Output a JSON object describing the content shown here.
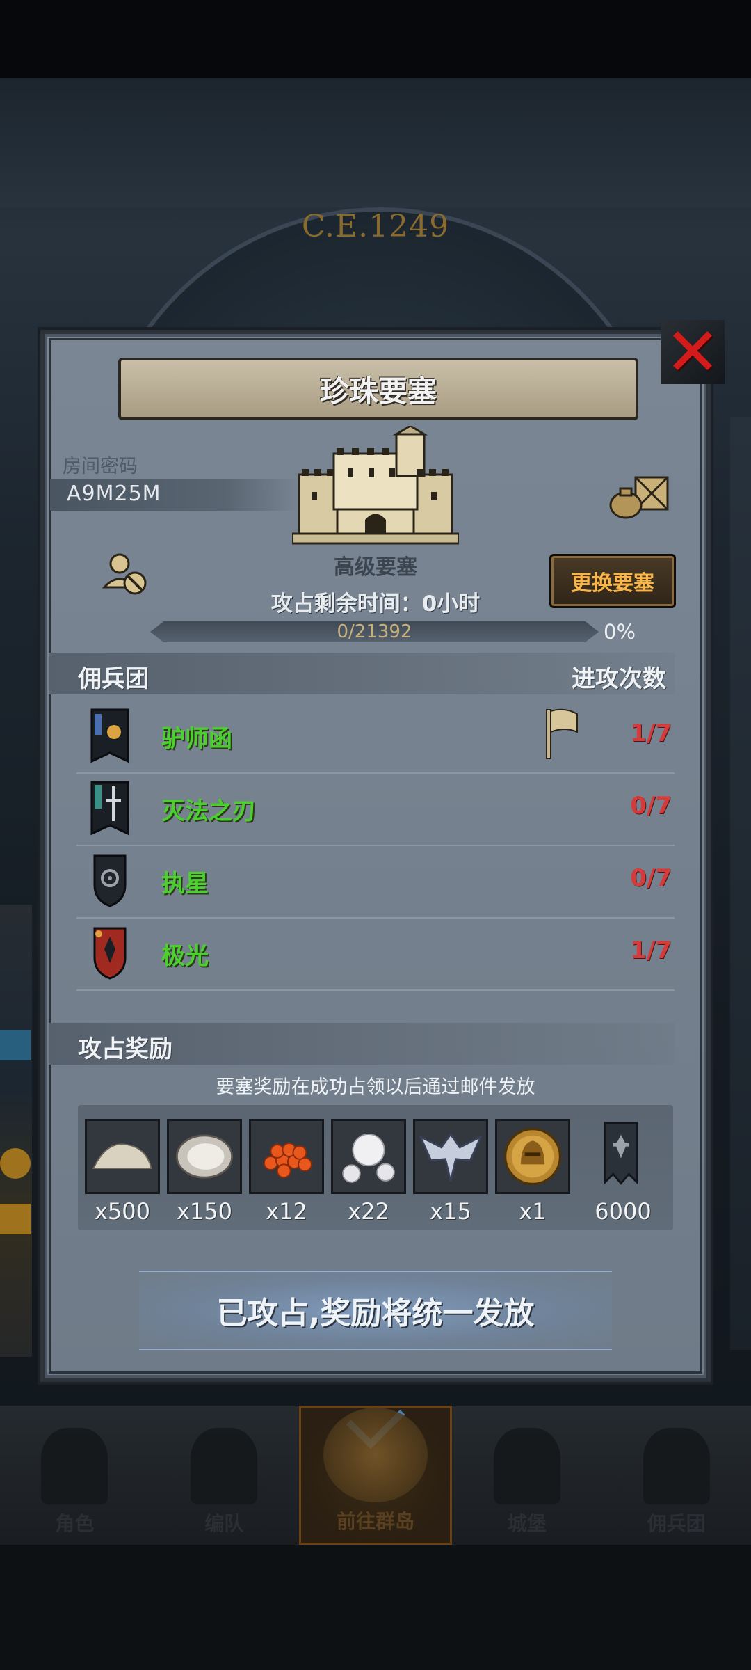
{
  "background": {
    "year": "C.E.1249"
  },
  "dialog": {
    "title": "珍珠要塞",
    "room_code_label": "房间密码",
    "room_code": "A9M25M",
    "fort_type": "高级要塞",
    "change_fort_label": "更换要塞",
    "occupy_time_text": "攻占剩余时间：0小时",
    "progress": {
      "text": "0/21392",
      "percent_text": "0%",
      "fraction": 0
    },
    "mercenary_header": "佣兵团",
    "attack_count_header": "进攻次数",
    "mercenaries": [
      {
        "name": "驴师函",
        "count": "1/7",
        "flagged": true,
        "emblem_color": "#d9a441"
      },
      {
        "name": "灭法之刃",
        "count": "0/7",
        "flagged": false,
        "emblem_color": "#cfd6dd"
      },
      {
        "name": "执星",
        "count": "0/7",
        "flagged": false,
        "emblem_color": "#9aa3ac"
      },
      {
        "name": "极光",
        "count": "1/7",
        "flagged": false,
        "emblem_color": "#c0392b"
      }
    ],
    "reward_header": "攻占奖励",
    "reward_note": "要塞奖励在成功占领以后通过邮件发放",
    "rewards": [
      {
        "icon": "sand-icon",
        "qty": "x500"
      },
      {
        "icon": "oyster-icon",
        "qty": "x150"
      },
      {
        "icon": "roe-icon",
        "qty": "x12"
      },
      {
        "icon": "pearl-icon",
        "qty": "x22"
      },
      {
        "icon": "wing-badge-icon",
        "qty": "x15"
      },
      {
        "icon": "helmet-coin-icon",
        "qty": "x1"
      },
      {
        "icon": "banner-icon",
        "qty": "6000"
      }
    ],
    "conquered_label": "已攻占,奖励将统一发放"
  },
  "bottom_nav": [
    {
      "label": "角色",
      "active": false
    },
    {
      "label": "编队",
      "active": false
    },
    {
      "label": "前往群岛",
      "active": true
    },
    {
      "label": "城堡",
      "active": false
    },
    {
      "label": "佣兵团",
      "active": false
    }
  ],
  "colors": {
    "name_green": "#4bd02d",
    "count_red": "#d63b3b",
    "close_red": "#d21c1c",
    "button_orange": "#f7b54a"
  }
}
